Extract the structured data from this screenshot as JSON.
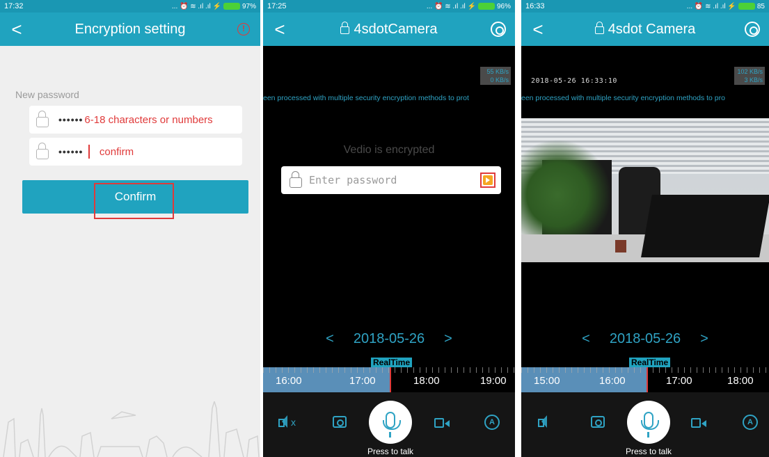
{
  "screen1": {
    "status_time": "17:32",
    "status_battery": "97%",
    "title": "Encryption setting",
    "back_symbol": "<",
    "new_password_label": "New password",
    "password_dots": "••••••",
    "password_hint": "6-18 characters or numbers",
    "confirm_dots": "••••••",
    "confirm_hint": "confirm",
    "confirm_button": "Confirm",
    "warn_symbol": "!"
  },
  "screen2": {
    "status_time": "17:25",
    "status_battery": "96%",
    "title": "4sdotCamera",
    "back_symbol": "<",
    "kbs_top": "55 KB/s",
    "kbs_bottom": "0 KB/s",
    "marquee": "een processed with multiple security encryption methods to prot",
    "encrypted_label": "Vedio is encrypted",
    "password_placeholder": "Enter password",
    "date": "2018-05-26",
    "realtime": "RealTime",
    "timeline_labels": [
      "16:00",
      "17:00",
      "18:00",
      "19:00"
    ],
    "press_to_talk": "Press to talk"
  },
  "screen3": {
    "status_time": "16:33",
    "status_battery": "85",
    "title": "4sdot Camera",
    "back_symbol": "<",
    "timestamp": "2018-05-26 16:33:10",
    "kbs_top": "102 KB/s",
    "kbs_bottom": "3 KB/s",
    "marquee": "een processed with multiple security encryption methods to pro",
    "date": "2018-05-26",
    "realtime": "RealTime",
    "timeline_labels": [
      "15:00",
      "16:00",
      "17:00",
      "18:00"
    ],
    "press_to_talk": "Press to talk"
  },
  "symbols": {
    "prev": "<",
    "next": ">",
    "auto": "A",
    "status_icons": "... ⏰ ≋ .ıl .ıl ⚡",
    "mute_x": "x"
  },
  "colors": {
    "accent": "#20a3bf",
    "status_bar": "#1a97b3",
    "alert_red": "#e03a3a",
    "text_blue": "#2fa3c4"
  }
}
